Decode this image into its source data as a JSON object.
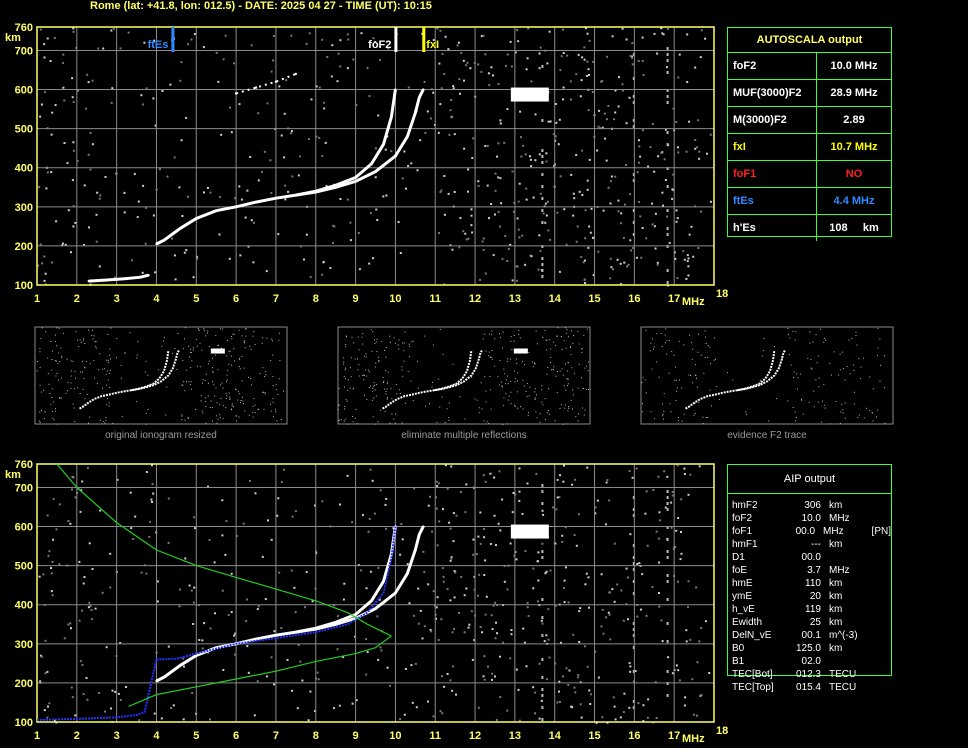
{
  "header": {
    "title": "Rome (lat: +41.8, lon: 012.5) - DATE: 2025 04 27 - TIME (UT): 10:15"
  },
  "colors": {
    "axis": "#ffff66",
    "grid": "#8a8a8a",
    "frame": "#3aff3a",
    "foF2": "#ffffff",
    "fxI": "#ffff00",
    "ftEs": "#2e8bff",
    "foF1": "#ff2020",
    "profile": "#22cc22",
    "aipTrace": "#2233ff"
  },
  "autoscala": {
    "title": "AUTOSCALA output",
    "rows": [
      {
        "label": "foF2",
        "value": "10.0 MHz",
        "color": "#ffffff"
      },
      {
        "label": "MUF(3000)F2",
        "value": "28.9 MHz",
        "color": "#ffffff"
      },
      {
        "label": "M(3000)F2",
        "value": "2.89",
        "color": "#ffffff"
      },
      {
        "label": "fxI",
        "value": "10.7 MHz",
        "color": "#ffff00"
      },
      {
        "label": "foF1",
        "value": "NO",
        "color": "#ff2020"
      },
      {
        "label": "ftEs",
        "value": "4.4 MHz",
        "color": "#2e8bff"
      },
      {
        "label": "h'Es",
        "value": "108     km",
        "color": "#ffffff"
      }
    ]
  },
  "aip": {
    "title": "AIP output",
    "rows": [
      {
        "p": "hmF2",
        "v": "306",
        "u": "km",
        "x": ""
      },
      {
        "p": "foF2",
        "v": "10.0",
        "u": "MHz",
        "x": ""
      },
      {
        "p": "foF1",
        "v": "00.0",
        "u": "MHz",
        "x": "[PN]"
      },
      {
        "p": "hmF1",
        "v": "---",
        "u": "km",
        "x": ""
      },
      {
        "p": "D1",
        "v": "00.0",
        "u": "",
        "x": ""
      },
      {
        "p": "foE",
        "v": "3.7",
        "u": "MHz",
        "x": ""
      },
      {
        "p": "hmE",
        "v": "110",
        "u": "km",
        "x": ""
      },
      {
        "p": "ymE",
        "v": "20",
        "u": "km",
        "x": ""
      },
      {
        "p": "h_vE",
        "v": "119",
        "u": "km",
        "x": ""
      },
      {
        "p": "Ewidth",
        "v": "25",
        "u": "km",
        "x": ""
      },
      {
        "p": "DelN_vE",
        "v": "00.1",
        "u": "m^(-3)",
        "x": ""
      },
      {
        "p": "B0",
        "v": "125.0",
        "u": "km",
        "x": ""
      },
      {
        "p": "B1",
        "v": "02.0",
        "u": "",
        "x": ""
      },
      {
        "p": "TEC[Bot]",
        "v": "012.3",
        "u": "TECU",
        "x": ""
      },
      {
        "p": "TEC[Top]",
        "v": "015.4",
        "u": "TECU",
        "x": ""
      }
    ]
  },
  "captions": {
    "original": "original ionogram resized",
    "multiple": "eliminate multiple reflections",
    "evidence": "evidence F2 trace"
  },
  "chart_data": [
    {
      "type": "scatter",
      "panel": "top-ionogram",
      "xlabel": "MHz",
      "ylabel": "km",
      "xlim": [
        1,
        18
      ],
      "ylim": [
        100,
        760
      ],
      "xticks": [
        1,
        2,
        3,
        4,
        5,
        6,
        7,
        8,
        9,
        10,
        11,
        12,
        13,
        14,
        15,
        16,
        17,
        18
      ],
      "yticks": [
        100,
        200,
        300,
        400,
        500,
        600,
        700,
        760
      ],
      "grid": true,
      "markers": [
        {
          "name": "ftEs",
          "x": 4.4,
          "color": "#2e8bff"
        },
        {
          "name": "foF2",
          "x": 10.0,
          "color": "#ffffff"
        },
        {
          "name": "fxI",
          "x": 10.7,
          "color": "#ffff00"
        }
      ],
      "series": [
        {
          "kind": "trace-o",
          "x": [
            4.0,
            4.2,
            4.6,
            5.0,
            5.5,
            6.0,
            6.5,
            7.0,
            7.5,
            8.0,
            8.5,
            9.0,
            9.4,
            9.7,
            9.9,
            10.0
          ],
          "y": [
            205,
            215,
            245,
            270,
            290,
            300,
            312,
            322,
            330,
            340,
            355,
            375,
            410,
            460,
            530,
            600
          ]
        },
        {
          "kind": "trace-x",
          "x": [
            7.5,
            8.0,
            8.5,
            9.0,
            9.5,
            10.0,
            10.3,
            10.5,
            10.6,
            10.7
          ],
          "y": [
            330,
            338,
            350,
            365,
            390,
            430,
            480,
            540,
            580,
            600
          ]
        },
        {
          "kind": "es",
          "x": [
            2.3,
            2.8,
            3.2,
            3.6,
            3.8
          ],
          "y": [
            110,
            113,
            116,
            120,
            125
          ]
        },
        {
          "kind": "multiple",
          "x": [
            6.0,
            6.5,
            7.0,
            7.5
          ],
          "y": [
            590,
            605,
            620,
            640
          ]
        }
      ]
    },
    {
      "type": "scatter",
      "panel": "bottom-aip",
      "xlabel": "MHz",
      "ylabel": "km",
      "xlim": [
        1,
        18
      ],
      "ylim": [
        100,
        760
      ],
      "xticks": [
        1,
        2,
        3,
        4,
        5,
        6,
        7,
        8,
        9,
        10,
        11,
        12,
        13,
        14,
        15,
        16,
        17,
        18
      ],
      "yticks": [
        100,
        200,
        300,
        400,
        500,
        600,
        700,
        760
      ],
      "grid": true,
      "series": [
        {
          "kind": "trace-o",
          "x": [
            4.0,
            4.2,
            4.6,
            5.0,
            5.5,
            6.0,
            6.5,
            7.0,
            7.5,
            8.0,
            8.5,
            9.0,
            9.4,
            9.7,
            9.9,
            10.0
          ],
          "y": [
            205,
            215,
            245,
            270,
            290,
            300,
            312,
            322,
            330,
            340,
            355,
            375,
            410,
            460,
            530,
            600
          ]
        },
        {
          "kind": "trace-x",
          "x": [
            7.5,
            8.0,
            8.5,
            9.0,
            9.5,
            10.0,
            10.3,
            10.5,
            10.6,
            10.7
          ],
          "y": [
            330,
            338,
            350,
            365,
            390,
            430,
            480,
            540,
            580,
            600
          ]
        },
        {
          "kind": "aip-trace",
          "x": [
            1.0,
            2.0,
            3.0,
            3.5,
            3.7,
            4.0,
            4.5,
            5.0,
            6.0,
            7.0,
            8.0,
            8.8,
            9.3,
            9.7,
            9.9,
            10.0
          ],
          "y": [
            105,
            108,
            112,
            118,
            125,
            260,
            262,
            275,
            300,
            315,
            330,
            350,
            380,
            430,
            520,
            600
          ]
        },
        {
          "kind": "profile-upper",
          "x": [
            1.5,
            2.0,
            3.0,
            4.0,
            5.0,
            6.0,
            7.0,
            8.0,
            8.8,
            9.3,
            9.9
          ],
          "y": [
            760,
            700,
            610,
            540,
            500,
            470,
            440,
            410,
            380,
            350,
            320
          ]
        },
        {
          "kind": "profile-lower",
          "x": [
            9.9,
            9.5,
            9.0,
            8.0,
            7.0,
            6.0,
            5.0,
            4.0,
            3.3
          ],
          "y": [
            320,
            290,
            275,
            255,
            230,
            210,
            190,
            170,
            140
          ]
        }
      ]
    }
  ]
}
